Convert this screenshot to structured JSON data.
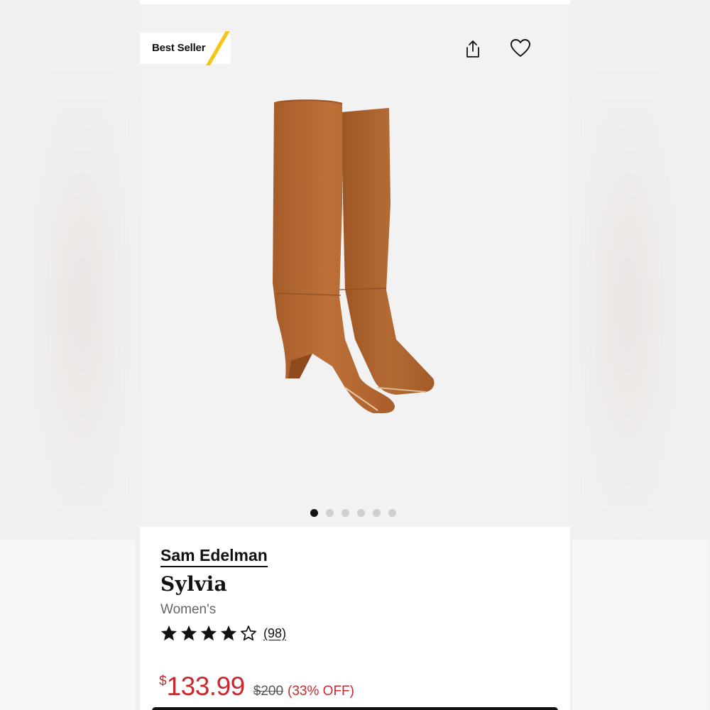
{
  "colors": {
    "accent_yellow": "#f5c518",
    "sale_red": "#c8292e",
    "gallery_bg": "#f2f2f2",
    "boot_suede": "#b66a34"
  },
  "gallery": {
    "badge_label": "Best Seller",
    "share_icon": "share-icon",
    "favorite_icon": "heart-icon",
    "image_count": 6,
    "active_index": 0
  },
  "product": {
    "brand": "Sam Edelman",
    "name": "Sylvia",
    "gender": "Women's",
    "rating": 4,
    "rating_max": 5,
    "review_count": "(98)",
    "currency_symbol": "$",
    "price": "133.99",
    "original_price": "$200",
    "discount": "(33% OFF)"
  }
}
